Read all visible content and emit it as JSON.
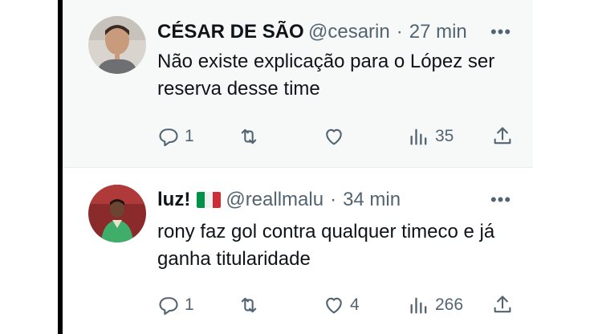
{
  "tweets": [
    {
      "name": "CÉSAR DE SÃO",
      "handle": "@cesarin",
      "time": "27 min",
      "text": "Não existe explicação para o López ser reserva desse time",
      "reply_count": "1",
      "retweet_count": "",
      "like_count": "",
      "views_count": "35",
      "more_label": "•••"
    },
    {
      "name": "luz!",
      "handle": "@reallmalu",
      "time": "34 min",
      "text": "rony faz gol contra qualquer timeco e já ganha titularidade",
      "reply_count": "1",
      "retweet_count": "",
      "like_count": "4",
      "views_count": "266",
      "more_label": "•••"
    }
  ],
  "separator": "·",
  "icons": {
    "reply": "reply-icon",
    "retweet": "retweet-icon",
    "like": "heart-icon",
    "views": "views-icon",
    "share": "share-icon",
    "flag": "italy-flag-icon"
  },
  "colors": {
    "text": "#0f1419",
    "secondary": "#536471",
    "flag_green": "#009246",
    "flag_white": "#ffffff",
    "flag_red": "#ce2b37"
  }
}
